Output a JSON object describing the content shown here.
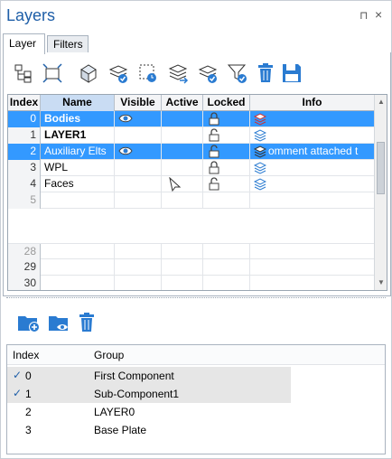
{
  "panel": {
    "title": "Layers",
    "pin_glyph": "⊓",
    "close_glyph": "×"
  },
  "tabs": [
    {
      "label": "Layer",
      "active": true
    },
    {
      "label": "Filters",
      "active": false
    }
  ],
  "toolbar": {
    "icons": [
      "tree-icon",
      "fit-box-icon",
      "layer-cube-icon",
      "layer-stack-check-icon",
      "timer-box-icon",
      "layers-arrow-icon",
      "layers-add-icon",
      "funnel-check-icon",
      "trash-icon",
      "save-icon"
    ]
  },
  "layers_grid": {
    "columns": [
      "Index",
      "Name",
      "Visible",
      "Active",
      "Locked",
      "Info"
    ],
    "rows": [
      {
        "index": "0",
        "name": "Bodies",
        "visible": true,
        "active": false,
        "locked": true,
        "info": "",
        "selected": true,
        "bold": true
      },
      {
        "index": "1",
        "name": "LAYER1",
        "visible": false,
        "active": false,
        "locked": false,
        "info": "",
        "selected": false,
        "bold": true
      },
      {
        "index": "2",
        "name": "Auxiliary Elts",
        "visible": true,
        "active": false,
        "locked": false,
        "info": "omment attached t",
        "selected": true,
        "bold": false
      },
      {
        "index": "3",
        "name": "WPL",
        "visible": false,
        "active": false,
        "locked": true,
        "info": "",
        "selected": false,
        "bold": false
      },
      {
        "index": "4",
        "name": "Faces",
        "visible": false,
        "active": false,
        "locked": false,
        "info": "",
        "selected": false,
        "bold": false
      },
      {
        "index": "5",
        "name": "",
        "visible": false,
        "active": false,
        "locked": false,
        "info": "",
        "selected": false,
        "bold": false
      }
    ],
    "tail_rows": [
      "28",
      "29",
      "30"
    ]
  },
  "lower_toolbar": {
    "icons": [
      "folder-add-icon",
      "folder-view-icon",
      "trash-icon"
    ]
  },
  "groups": {
    "columns": [
      "Index",
      "Group"
    ],
    "rows": [
      {
        "index": "0",
        "group": "First Component",
        "checked": true
      },
      {
        "index": "1",
        "group": "Sub-Component1",
        "checked": true
      },
      {
        "index": "2",
        "group": "LAYER0",
        "checked": false
      },
      {
        "index": "3",
        "group": "Base Plate",
        "checked": false
      }
    ]
  },
  "colors": {
    "selection": "#3399ff",
    "accent": "#1f5fa8"
  }
}
